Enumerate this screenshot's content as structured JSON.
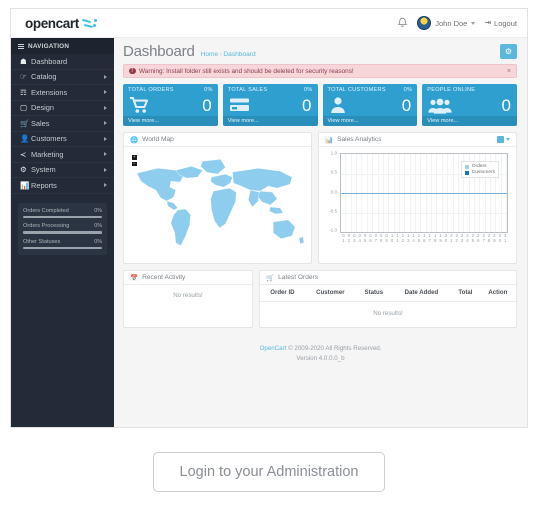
{
  "header": {
    "brand": "opencart",
    "bell_icon": "bell-icon",
    "user_name": "John Doe",
    "logout_label": "Logout",
    "logout_icon": "logout-icon"
  },
  "sidebar": {
    "nav_header": "NAVIGATION",
    "items": [
      {
        "label": "Dashboard",
        "icon": "home-icon",
        "has_arrow": false
      },
      {
        "label": "Catalog",
        "icon": "tag-icon",
        "has_arrow": true
      },
      {
        "label": "Extensions",
        "icon": "puzzle-icon",
        "has_arrow": true
      },
      {
        "label": "Design",
        "icon": "monitor-icon",
        "has_arrow": true
      },
      {
        "label": "Sales",
        "icon": "cart-icon",
        "has_arrow": true
      },
      {
        "label": "Customers",
        "icon": "user-icon",
        "has_arrow": true
      },
      {
        "label": "Marketing",
        "icon": "share-icon",
        "has_arrow": true
      },
      {
        "label": "System",
        "icon": "gear-icon",
        "has_arrow": true
      },
      {
        "label": "Reports",
        "icon": "bar-chart-icon",
        "has_arrow": true
      }
    ],
    "progress": [
      {
        "label": "Orders Completed",
        "percent": "0%",
        "value": 0
      },
      {
        "label": "Orders Processing",
        "percent": "0%",
        "value": 0
      },
      {
        "label": "Other Statuses",
        "percent": "0%",
        "value": 0
      }
    ]
  },
  "page": {
    "title": "Dashboard",
    "breadcrumb_home": "Home",
    "breadcrumb_sep": "›",
    "breadcrumb_current": "Dashboard",
    "settings_icon": "gear-icon"
  },
  "alert": {
    "icon": "exclamation-icon",
    "text": "Warning: Install folder still exists and should be deleted for security reasons!",
    "close_icon": "close-icon"
  },
  "cards": [
    {
      "title": "TOTAL ORDERS",
      "percent": "0%",
      "value": "0",
      "footer": "View more...",
      "icon": "cart-icon"
    },
    {
      "title": "TOTAL SALES",
      "percent": "0%",
      "value": "0",
      "footer": "View more...",
      "icon": "credit-card-icon"
    },
    {
      "title": "TOTAL CUSTOMERS",
      "percent": "0%",
      "value": "0",
      "footer": "View more...",
      "icon": "user-icon"
    },
    {
      "title": "PEOPLE ONLINE",
      "percent": "",
      "value": "0",
      "footer": "View more...",
      "icon": "users-icon"
    }
  ],
  "map_panel": {
    "title": "World Map",
    "icon": "globe-icon",
    "zoom_in": "+",
    "zoom_out": "−"
  },
  "chart_panel": {
    "title": "Sales Analytics",
    "icon": "bar-chart-icon",
    "dropdown_icon": "calendar-dropdown-icon"
  },
  "chart_data": {
    "type": "line",
    "title": "Sales Analytics",
    "xlabel": "",
    "ylabel": "",
    "ylim": [
      -1.0,
      1.0
    ],
    "yticks": [
      "1.0",
      "0.5",
      "0.0",
      "-0.5",
      "-1.0"
    ],
    "grid": true,
    "legend_position": "top-right",
    "x": [
      "01",
      "02",
      "03",
      "04",
      "05",
      "06",
      "07",
      "08",
      "09",
      "10",
      "11",
      "12",
      "13",
      "14",
      "15",
      "16",
      "17",
      "18",
      "19",
      "20",
      "21",
      "22",
      "23",
      "24",
      "25",
      "26",
      "27",
      "28",
      "29",
      "30",
      "31"
    ],
    "series": [
      {
        "name": "Orders",
        "color": "#9fd0ea",
        "values": [
          0,
          0,
          0,
          0,
          0,
          0,
          0,
          0,
          0,
          0,
          0,
          0,
          0,
          0,
          0,
          0,
          0,
          0,
          0,
          0,
          0,
          0,
          0,
          0,
          0,
          0,
          0,
          0,
          0,
          0,
          0
        ]
      },
      {
        "name": "Customers",
        "color": "#1b6fc4",
        "values": [
          0,
          0,
          0,
          0,
          0,
          0,
          0,
          0,
          0,
          0,
          0,
          0,
          0,
          0,
          0,
          0,
          0,
          0,
          0,
          0,
          0,
          0,
          0,
          0,
          0,
          0,
          0,
          0,
          0,
          0,
          0
        ]
      }
    ]
  },
  "activity_panel": {
    "title": "Recent Activity",
    "icon": "calendar-icon",
    "empty_text": "No results!"
  },
  "orders_panel": {
    "title": "Latest Orders",
    "icon": "cart-icon",
    "columns": [
      "Order ID",
      "Customer",
      "Status",
      "Date Added",
      "Total",
      "Action"
    ],
    "rows": [],
    "empty_text": "No results!"
  },
  "footer": {
    "brand": "OpenCart",
    "copyright": "© 2009-2020 All Rights Reserved.",
    "version": "Version 4.0.0.0_b"
  },
  "login_button": {
    "label": "Login to your Administration"
  },
  "colors": {
    "accent": "#5bb7db",
    "card": "#2f9fd0",
    "sidebar": "#232b38",
    "alert_bg": "#f6d6d8",
    "map_land": "#8ecdee"
  }
}
